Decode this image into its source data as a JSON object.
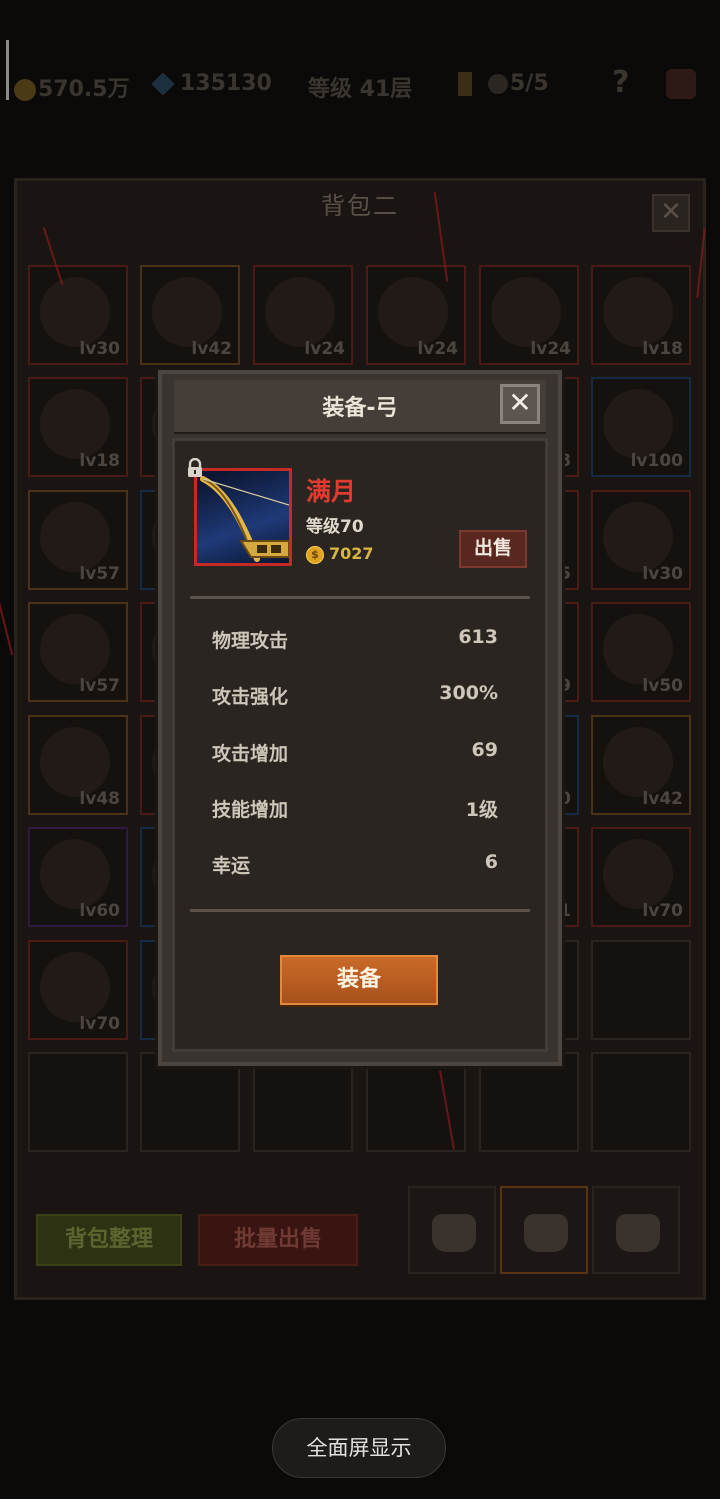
{
  "hud": {
    "gold": "570.5万",
    "gems": "135130",
    "floor": "等级 41层",
    "keys": "5/5",
    "help": "?"
  },
  "bag": {
    "title": "背包二",
    "close": "✕",
    "slots": [
      {
        "lv": "lv30",
        "frame": "red"
      },
      {
        "lv": "lv42",
        "frame": "orange"
      },
      {
        "lv": "lv24",
        "frame": "red"
      },
      {
        "lv": "lv24",
        "frame": "red"
      },
      {
        "lv": "lv24",
        "frame": "red"
      },
      {
        "lv": "lv18",
        "frame": "red"
      },
      {
        "lv": "lv18",
        "frame": "red"
      },
      {
        "lv": "",
        "frame": "red"
      },
      {
        "lv": "",
        "frame": "red"
      },
      {
        "lv": "",
        "frame": "red"
      },
      {
        "lv": "8",
        "frame": "red"
      },
      {
        "lv": "lv100",
        "frame": "blue"
      },
      {
        "lv": "lv57",
        "frame": "orange"
      },
      {
        "lv": "",
        "frame": "blue"
      },
      {
        "lv": "",
        "frame": "red"
      },
      {
        "lv": "",
        "frame": "red"
      },
      {
        "lv": "5",
        "frame": "red"
      },
      {
        "lv": "lv30",
        "frame": "red"
      },
      {
        "lv": "lv57",
        "frame": "orange"
      },
      {
        "lv": "",
        "frame": "red"
      },
      {
        "lv": "",
        "frame": "red"
      },
      {
        "lv": "",
        "frame": "red"
      },
      {
        "lv": "9",
        "frame": "red"
      },
      {
        "lv": "lv50",
        "frame": "red"
      },
      {
        "lv": "lv48",
        "frame": "orange"
      },
      {
        "lv": "",
        "frame": "red"
      },
      {
        "lv": "",
        "frame": "red"
      },
      {
        "lv": "",
        "frame": "red"
      },
      {
        "lv": "00",
        "frame": "blue"
      },
      {
        "lv": "lv42",
        "frame": "orange"
      },
      {
        "lv": "lv60",
        "frame": "purple"
      },
      {
        "lv": "",
        "frame": "blue"
      },
      {
        "lv": "",
        "frame": "red"
      },
      {
        "lv": "",
        "frame": "red"
      },
      {
        "lv": "1",
        "frame": "red"
      },
      {
        "lv": "lv70",
        "frame": "red"
      },
      {
        "lv": "lv70",
        "frame": "red"
      },
      {
        "lv": "",
        "frame": "blue"
      },
      {
        "lv": "",
        "frame": "empty"
      },
      {
        "lv": "",
        "frame": "empty"
      },
      {
        "lv": "",
        "frame": "empty"
      },
      {
        "lv": "",
        "frame": "empty"
      },
      {
        "lv": "",
        "frame": "empty"
      },
      {
        "lv": "",
        "frame": "empty"
      },
      {
        "lv": "",
        "frame": "empty"
      },
      {
        "lv": "",
        "frame": "empty"
      },
      {
        "lv": "",
        "frame": "empty"
      },
      {
        "lv": "",
        "frame": "empty"
      }
    ],
    "sort_label": "背包整理",
    "bulk_sell_label": "批量出售",
    "active_tab": 1
  },
  "modal": {
    "title": "装备-弓",
    "close": "✕",
    "item_name": "满月",
    "item_level": "等级70",
    "price": "7027",
    "sell_label": "出售",
    "stats": [
      {
        "label": "物理攻击",
        "value": "613"
      },
      {
        "label": "攻击强化",
        "value": "300%"
      },
      {
        "label": "攻击增加",
        "value": "69"
      },
      {
        "label": "技能增加",
        "value": "1级"
      },
      {
        "label": "幸运",
        "value": "6"
      }
    ],
    "equip_label": "装备",
    "colors": {
      "name": "#e23a2e",
      "price": "#d9b640",
      "equip": "#c96a28"
    }
  },
  "fullscreen_label": "全面屏显示"
}
